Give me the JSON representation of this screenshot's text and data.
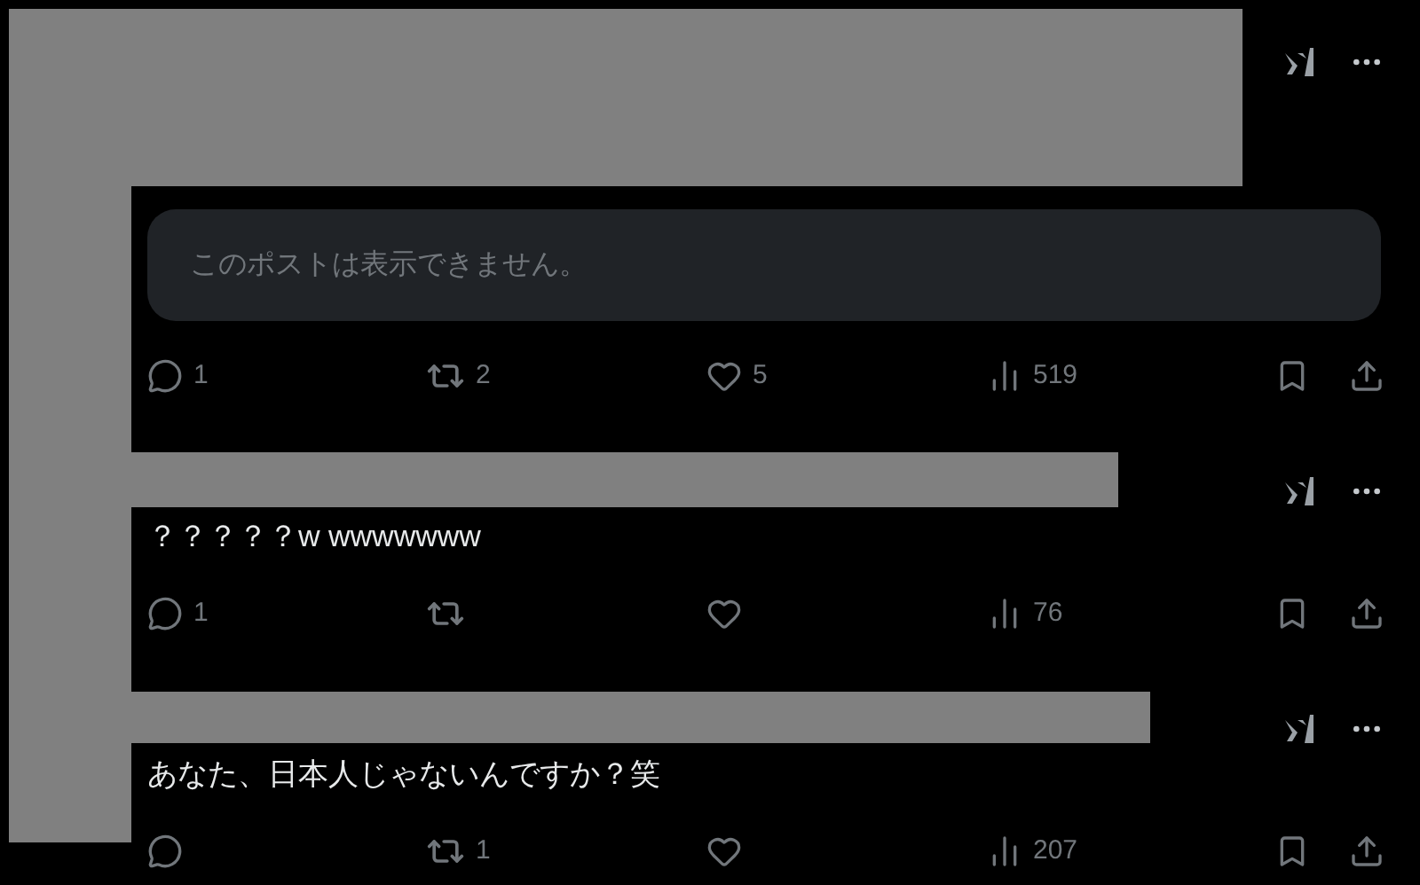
{
  "posts": [
    {
      "kind": "quote",
      "quote_text": "このポストは表示できません。",
      "reply_count": "1",
      "repost_count": "2",
      "like_count": "5",
      "view_count": "519"
    },
    {
      "kind": "text",
      "text": "？？？？？w wwwwwww",
      "reply_count": "1",
      "view_count": "76"
    },
    {
      "kind": "text",
      "text": "あなた、日本人じゃないんですか？笑",
      "repost_count": "1",
      "view_count": "207"
    }
  ]
}
